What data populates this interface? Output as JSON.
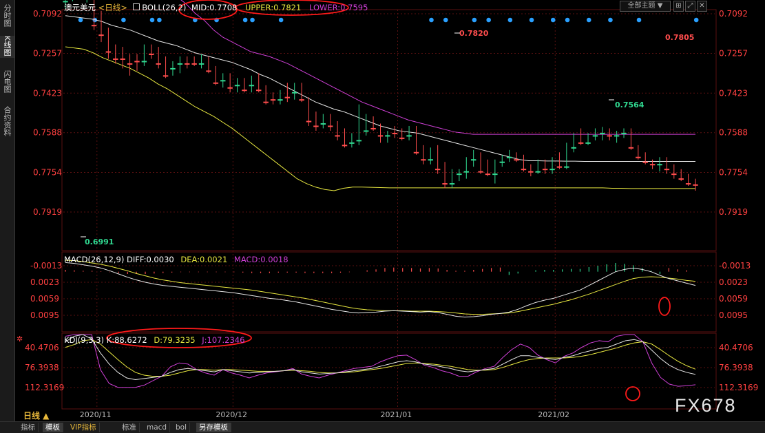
{
  "sidebar": {
    "tabs": [
      {
        "label": "分时图"
      },
      {
        "label": "K线图"
      },
      {
        "label": "闪电图"
      },
      {
        "label": "合约资料"
      }
    ]
  },
  "header": {
    "symbol": "澳元美元",
    "period_tag": "<日线>",
    "boll": "BOLL(26,2)",
    "mid": "MID:0.7708",
    "upper": "UPPER:0.7821",
    "lower": "LOWER:0.7595",
    "theme_select": "全部主题"
  },
  "macd_header": {
    "name": "MACD(26,12,9)",
    "diff": "DIFF:0.0030",
    "dea": "DEA:0.0021",
    "macd": "MACD:0.0018"
  },
  "kdj_header": {
    "name": "KDJ(9,3,3)",
    "k": "K:88.6272",
    "d": "D:79.3235",
    "j": "J:107.2346"
  },
  "period_label": "日线 ▲",
  "watermark": "FX678",
  "bottom_tabs": [
    "指标",
    "模板",
    "VIP指标",
    "标准",
    "macd",
    "bol",
    "另存模板"
  ],
  "colors": {
    "up": "#ff4d4d",
    "down": "#30d890",
    "mid": "#e8e8e8",
    "upper": "#e8e840",
    "lower": "#d040d8",
    "grid": "#5a1010",
    "axis_text": "#ff4040",
    "dots": "#2aa0ff"
  },
  "chart_data": [
    {
      "type": "candlestick",
      "title": "澳元美元 日线",
      "y_ticks": [
        "0.7919",
        "0.7754",
        "0.7588",
        "0.7423",
        "0.7257",
        "0.7092"
      ],
      "x_ticks": [
        "2020/11",
        "2020/12",
        "2021/01",
        "2021/02"
      ],
      "annotations": [
        {
          "label": "0.7820",
          "kind": "high"
        },
        {
          "label": "0.7805",
          "kind": "last"
        },
        {
          "label": "0.7564",
          "kind": "low"
        },
        {
          "label": "0.6991",
          "kind": "low"
        }
      ],
      "ohlc": [
        [
          0.704,
          0.707,
          0.6995,
          0.701
        ],
        [
          0.701,
          0.704,
          0.6991,
          0.7
        ],
        [
          0.7005,
          0.7025,
          0.6995,
          0.7015
        ],
        [
          0.7025,
          0.7045,
          0.7,
          0.702
        ],
        [
          0.703,
          0.716,
          0.702,
          0.714
        ],
        [
          0.71,
          0.721,
          0.708,
          0.718
        ],
        [
          0.718,
          0.728,
          0.715,
          0.725
        ],
        [
          0.725,
          0.73,
          0.722,
          0.728
        ],
        [
          0.726,
          0.732,
          0.723,
          0.728
        ],
        [
          0.728,
          0.735,
          0.726,
          0.73
        ],
        [
          0.728,
          0.733,
          0.726,
          0.729
        ],
        [
          0.729,
          0.731,
          0.722,
          0.724
        ],
        [
          0.724,
          0.728,
          0.722,
          0.726
        ],
        [
          0.725,
          0.732,
          0.723,
          0.73
        ],
        [
          0.729,
          0.736,
          0.727,
          0.735
        ],
        [
          0.732,
          0.735,
          0.729,
          0.731
        ],
        [
          0.73,
          0.734,
          0.727,
          0.729
        ],
        [
          0.729,
          0.732,
          0.727,
          0.73
        ],
        [
          0.728,
          0.731,
          0.727,
          0.73
        ],
        [
          0.73,
          0.732,
          0.726,
          0.728
        ],
        [
          0.728,
          0.734,
          0.727,
          0.733
        ],
        [
          0.732,
          0.739,
          0.731,
          0.738
        ],
        [
          0.737,
          0.74,
          0.734,
          0.736
        ],
        [
          0.736,
          0.742,
          0.734,
          0.74
        ],
        [
          0.739,
          0.742,
          0.736,
          0.738
        ],
        [
          0.738,
          0.742,
          0.736,
          0.741
        ],
        [
          0.739,
          0.742,
          0.735,
          0.736
        ],
        [
          0.736,
          0.742,
          0.734,
          0.741
        ],
        [
          0.741,
          0.747,
          0.739,
          0.746
        ],
        [
          0.744,
          0.747,
          0.742,
          0.745
        ],
        [
          0.745,
          0.747,
          0.741,
          0.743
        ],
        [
          0.743,
          0.746,
          0.738,
          0.744
        ],
        [
          0.742,
          0.745,
          0.738,
          0.74
        ],
        [
          0.74,
          0.746,
          0.738,
          0.745
        ],
        [
          0.745,
          0.756,
          0.744,
          0.754
        ],
        [
          0.753,
          0.758,
          0.75,
          0.756
        ],
        [
          0.755,
          0.757,
          0.751,
          0.752
        ],
        [
          0.752,
          0.758,
          0.751,
          0.756
        ],
        [
          0.755,
          0.762,
          0.754,
          0.76
        ],
        [
          0.758,
          0.765,
          0.757,
          0.764
        ],
        [
          0.763,
          0.765,
          0.759,
          0.762
        ],
        [
          0.762,
          0.764,
          0.747,
          0.758
        ],
        [
          0.758,
          0.76,
          0.751,
          0.753
        ],
        [
          0.753,
          0.758,
          0.752,
          0.757
        ],
        [
          0.757,
          0.763,
          0.755,
          0.76
        ],
        [
          0.76,
          0.763,
          0.758,
          0.759
        ],
        [
          0.758,
          0.761,
          0.756,
          0.759
        ],
        [
          0.759,
          0.762,
          0.757,
          0.761
        ],
        [
          0.76,
          0.762,
          0.756,
          0.758
        ],
        [
          0.758,
          0.768,
          0.756,
          0.767
        ],
        [
          0.767,
          0.772,
          0.764,
          0.77
        ],
        [
          0.77,
          0.772,
          0.765,
          0.766
        ],
        [
          0.766,
          0.776,
          0.764,
          0.774
        ],
        [
          0.773,
          0.782,
          0.771,
          0.78
        ],
        [
          0.78,
          0.782,
          0.774,
          0.776
        ],
        [
          0.776,
          0.779,
          0.774,
          0.775
        ],
        [
          0.775,
          0.778,
          0.769,
          0.77
        ],
        [
          0.77,
          0.773,
          0.766,
          0.768
        ],
        [
          0.768,
          0.776,
          0.767,
          0.775
        ],
        [
          0.774,
          0.777,
          0.77,
          0.776
        ],
        [
          0.776,
          0.78,
          0.77,
          0.771
        ],
        [
          0.771,
          0.773,
          0.768,
          0.769
        ],
        [
          0.769,
          0.771,
          0.766,
          0.768
        ],
        [
          0.768,
          0.771,
          0.767,
          0.77
        ],
        [
          0.77,
          0.775,
          0.768,
          0.774
        ],
        [
          0.774,
          0.777,
          0.772,
          0.775
        ],
        [
          0.775,
          0.776,
          0.77,
          0.772
        ],
        [
          0.772,
          0.776,
          0.77,
          0.774
        ],
        [
          0.774,
          0.776,
          0.769,
          0.77
        ],
        [
          0.77,
          0.774,
          0.767,
          0.773
        ],
        [
          0.773,
          0.774,
          0.763,
          0.765
        ],
        [
          0.765,
          0.767,
          0.759,
          0.761
        ],
        [
          0.761,
          0.764,
          0.757,
          0.763
        ],
        [
          0.763,
          0.764,
          0.759,
          0.76
        ],
        [
          0.76,
          0.762,
          0.757,
          0.759
        ],
        [
          0.759,
          0.762,
          0.7564,
          0.758
        ],
        [
          0.758,
          0.762,
          0.757,
          0.76
        ],
        [
          0.76,
          0.763,
          0.758,
          0.759
        ],
        [
          0.759,
          0.761,
          0.757,
          0.758
        ],
        [
          0.758,
          0.766,
          0.757,
          0.765
        ],
        [
          0.765,
          0.77,
          0.764,
          0.769
        ],
        [
          0.769,
          0.772,
          0.767,
          0.771
        ],
        [
          0.771,
          0.774,
          0.77,
          0.772
        ],
        [
          0.772,
          0.775,
          0.769,
          0.77
        ],
        [
          0.77,
          0.776,
          0.769,
          0.774
        ],
        [
          0.774,
          0.778,
          0.772,
          0.776
        ],
        [
          0.776,
          0.779,
          0.774,
          0.778
        ],
        [
          0.778,
          0.781,
          0.776,
          0.78
        ],
        [
          0.78,
          0.783,
          0.778,
          0.7805
        ]
      ],
      "mid": [
        0.71,
        0.7105,
        0.711,
        0.7115,
        0.7125,
        0.714,
        0.715,
        0.716,
        0.7175,
        0.719,
        0.7205,
        0.7215,
        0.7225,
        0.724,
        0.7255,
        0.7265,
        0.7275,
        0.7285,
        0.7295,
        0.731,
        0.7325,
        0.7345,
        0.736,
        0.738,
        0.74,
        0.742,
        0.744,
        0.746,
        0.7475,
        0.749,
        0.75,
        0.7515,
        0.753,
        0.7545,
        0.756,
        0.757,
        0.758,
        0.7585,
        0.759,
        0.76,
        0.761,
        0.762,
        0.763,
        0.764,
        0.765,
        0.766,
        0.767,
        0.768,
        0.769,
        0.77,
        0.7705,
        0.7705,
        0.7706,
        0.7706,
        0.7707,
        0.7707,
        0.7708,
        0.7708,
        0.7708,
        0.7708,
        0.7708,
        0.7708,
        0.7708,
        0.7708,
        0.7708,
        0.7708,
        0.7708,
        0.7708,
        0.7708
      ],
      "upper": [
        0.723,
        0.7235,
        0.724,
        0.7255,
        0.7275,
        0.729,
        0.7305,
        0.732,
        0.734,
        0.736,
        0.7385,
        0.7405,
        0.743,
        0.7455,
        0.748,
        0.75,
        0.752,
        0.7545,
        0.757,
        0.76,
        0.763,
        0.766,
        0.769,
        0.772,
        0.775,
        0.778,
        0.78,
        0.7815,
        0.7825,
        0.783,
        0.782,
        0.7815,
        0.7815,
        0.7816,
        0.7817,
        0.7818,
        0.7818,
        0.7818,
        0.7818,
        0.7818,
        0.7818,
        0.7818,
        0.7818,
        0.7818,
        0.7818,
        0.7818,
        0.7818,
        0.7818,
        0.7818,
        0.7818,
        0.7818,
        0.7818,
        0.7818,
        0.7818,
        0.7818,
        0.7818,
        0.7818,
        0.7818,
        0.7818,
        0.782,
        0.782,
        0.7821,
        0.7821,
        0.7821,
        0.7821,
        0.7821,
        0.7821,
        0.7821,
        0.7821
      ],
      "lower": [
        0.698,
        0.6975,
        0.697,
        0.6965,
        0.696,
        0.6955,
        0.6955,
        0.696,
        0.6965,
        0.6975,
        0.6985,
        0.7,
        0.702,
        0.705,
        0.709,
        0.712,
        0.716,
        0.719,
        0.721,
        0.723,
        0.725,
        0.726,
        0.727,
        0.7285,
        0.73,
        0.732,
        0.734,
        0.736,
        0.738,
        0.74,
        0.742,
        0.744,
        0.746,
        0.7475,
        0.749,
        0.7505,
        0.752,
        0.7535,
        0.7545,
        0.7555,
        0.7565,
        0.7575,
        0.7585,
        0.759,
        0.7595,
        0.7595,
        0.7595,
        0.7595,
        0.7595,
        0.7595,
        0.7595,
        0.7595,
        0.7595,
        0.7595,
        0.7595,
        0.7595,
        0.7595,
        0.7595,
        0.7595,
        0.7595,
        0.7595,
        0.7595,
        0.7595,
        0.7595,
        0.7595,
        0.7595,
        0.7595,
        0.7595,
        0.7595
      ]
    },
    {
      "type": "macd",
      "y_ticks": [
        "0.0095",
        "0.0059",
        "0.0023",
        "-0.0013"
      ],
      "diff": [
        -0.002,
        -0.0018,
        -0.0015,
        -0.0012,
        -0.0008,
        -0.0002,
        0.0005,
        0.0012,
        0.0018,
        0.0023,
        0.0027,
        0.003,
        0.0032,
        0.0034,
        0.0036,
        0.0038,
        0.004,
        0.0042,
        0.0044,
        0.0046,
        0.0049,
        0.0052,
        0.0055,
        0.0058,
        0.006,
        0.0063,
        0.0066,
        0.007,
        0.0074,
        0.0078,
        0.0082,
        0.0085,
        0.0088,
        0.009,
        0.0089,
        0.0088,
        0.0086,
        0.0085,
        0.0086,
        0.0087,
        0.0088,
        0.0087,
        0.0089,
        0.0093,
        0.0097,
        0.0099,
        0.0098,
        0.0096,
        0.0093,
        0.0091,
        0.0088,
        0.0082,
        0.0074,
        0.0067,
        0.0062,
        0.0058,
        0.0052,
        0.0046,
        0.004,
        0.003,
        0.002,
        0.001,
        0.0,
        -0.0005,
        -0.0008,
        -0.0005,
        0.0,
        0.0008,
        0.0015,
        0.002,
        0.0025,
        0.003
      ],
      "dea": [
        -0.0025,
        -0.0024,
        -0.0022,
        -0.0019,
        -0.0016,
        -0.0012,
        -0.0007,
        -0.0002,
        0.0004,
        0.0009,
        0.0014,
        0.0018,
        0.0021,
        0.0024,
        0.0026,
        0.0028,
        0.003,
        0.0032,
        0.0034,
        0.0036,
        0.0038,
        0.004,
        0.0043,
        0.0046,
        0.0049,
        0.0052,
        0.0055,
        0.0058,
        0.0062,
        0.0066,
        0.007,
        0.0074,
        0.0078,
        0.0081,
        0.0083,
        0.0084,
        0.0085,
        0.0085,
        0.0085,
        0.0086,
        0.0086,
        0.0086,
        0.0087,
        0.0088,
        0.009,
        0.0092,
        0.0093,
        0.0093,
        0.0092,
        0.0091,
        0.009,
        0.0087,
        0.0083,
        0.0079,
        0.0075,
        0.0071,
        0.0066,
        0.0061,
        0.0055,
        0.0049,
        0.0042,
        0.0035,
        0.0028,
        0.0021,
        0.0015,
        0.0012,
        0.0011,
        0.0012,
        0.0014,
        0.0016,
        0.0019,
        0.0021
      ],
      "hist": [
        0.0005,
        0.0006,
        0.0007,
        0.0007,
        0.0008,
        0.001,
        0.0012,
        0.0014,
        0.0014,
        0.0014,
        0.0013,
        0.0012,
        0.0011,
        0.001,
        0.001,
        0.001,
        0.001,
        0.001,
        0.001,
        0.001,
        0.0011,
        0.0012,
        0.0012,
        0.0012,
        0.0011,
        0.0011,
        0.0011,
        0.0012,
        0.0012,
        0.0012,
        0.0012,
        0.0011,
        0.001,
        0.0009,
        0.0006,
        0.0004,
        0.0001,
        0.0,
        0.0001,
        0.0001,
        0.0002,
        0.0001,
        0.0002,
        0.0005,
        0.0007,
        0.0007,
        0.0005,
        0.0003,
        0.0001,
        0.0,
        -0.0002,
        -0.0005,
        -0.0009,
        -0.0012,
        -0.0013,
        -0.0013,
        -0.0014,
        -0.0015,
        -0.0015,
        -0.0019,
        -0.0022,
        -0.0025,
        -0.0028,
        -0.0026,
        -0.0023,
        -0.0017,
        -0.0011,
        -0.0004,
        0.0001,
        0.0004,
        0.0006,
        0.0009
      ]
    },
    {
      "type": "kdj",
      "y_ticks": [
        "112.3169",
        "76.3938",
        "40.4706"
      ],
      "k": [
        30,
        20,
        15,
        25,
        50,
        70,
        85,
        95,
        98,
        96,
        94,
        92,
        85,
        80,
        78,
        80,
        82,
        84,
        80,
        82,
        84,
        86,
        85,
        84,
        83,
        82,
        80,
        84,
        86,
        88,
        87,
        86,
        84,
        82,
        80,
        78,
        74,
        70,
        66,
        64,
        66,
        70,
        72,
        75,
        78,
        82,
        84,
        82,
        80,
        78,
        70,
        62,
        55,
        55,
        58,
        60,
        62,
        58,
        55,
        50,
        46,
        42,
        40,
        34,
        28,
        26,
        30,
        45,
        60,
        72,
        80,
        85,
        88.6
      ],
      "d": [
        40,
        35,
        28,
        26,
        34,
        48,
        62,
        75,
        85,
        90,
        92,
        92,
        90,
        86,
        82,
        80,
        80,
        81,
        80,
        80,
        81,
        82,
        83,
        83,
        83,
        82,
        81,
        82,
        83,
        85,
        86,
        86,
        85,
        84,
        82,
        80,
        78,
        75,
        72,
        69,
        68,
        69,
        70,
        72,
        74,
        77,
        80,
        81,
        81,
        80,
        76,
        71,
        66,
        62,
        60,
        59,
        59,
        59,
        58,
        56,
        53,
        49,
        45,
        41,
        36,
        32,
        30,
        34,
        44,
        55,
        65,
        73,
        79.3
      ],
      "j": [
        20,
        5,
        -5,
        15,
        80,
        105,
        112,
        112,
        112,
        108,
        100,
        92,
        75,
        68,
        70,
        80,
        86,
        90,
        80,
        86,
        90,
        95,
        90,
        86,
        84,
        82,
        78,
        88,
        92,
        95,
        90,
        86,
        82,
        78,
        76,
        74,
        66,
        60,
        55,
        54,
        62,
        72,
        76,
        82,
        86,
        92,
        92,
        84,
        78,
        74,
        58,
        44,
        34,
        40,
        54,
        62,
        68,
        56,
        50,
        40,
        32,
        28,
        30,
        20,
        12,
        14,
        30,
        68,
        94,
        106,
        110,
        109,
        107.2
      ]
    }
  ]
}
